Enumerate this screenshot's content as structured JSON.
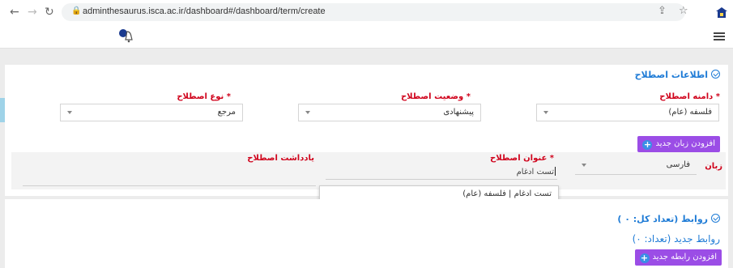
{
  "browser": {
    "url": "adminthesaurus.isca.ac.ir/dashboard#/dashboard/term/create",
    "icons": [
      "back-arrow-icon",
      "forward-arrow-icon",
      "reload-icon",
      "lock-icon",
      "share-icon",
      "star-icon",
      "extension-icon"
    ]
  },
  "appbar": {
    "icons": [
      "notification-bell-icon",
      "hamburger-menu-icon"
    ]
  },
  "term_info": {
    "title": "اطلاعات اصطلاح",
    "domain_label": "دامنه اصطلاح *",
    "domain_value": "فلسفه (عام)",
    "status_label": "وضعیت اصطلاح *",
    "status_value": "پیشنهادی",
    "type_label": "نوع اصطلاح *",
    "type_value": "مرجع",
    "add_language_button": "افزودن زبان جدید",
    "language_label": "زبان",
    "language_value": "فارسی",
    "term_title_label": "عنوان اصطلاح *",
    "term_title_value": "تست ادغام",
    "note_label": "یادداشت اصطلاح",
    "autocomplete_item": "تست ادغام | فلسفه (عام)"
  },
  "relations": {
    "title": "روابط (تعداد کل: ۰ )",
    "new_relations": "روابط جدید (تعداد: ۰)",
    "add_relation_button": "افزودن رابطه جدید"
  },
  "colors": {
    "accent_blue": "#1e7bd6",
    "required_red": "#d0021b",
    "button_purple": "#9b4de6"
  }
}
